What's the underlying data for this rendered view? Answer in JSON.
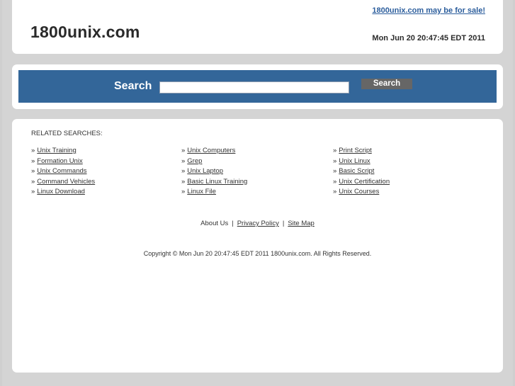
{
  "header": {
    "site_title": "1800unix.com",
    "sale_link": "1800unix.com may be for sale!",
    "datetime": "Mon Jun 20 20:47:45 EDT 2011"
  },
  "search": {
    "label": "Search",
    "input_value": "",
    "button_label": "Search"
  },
  "related": {
    "title": "RELATED SEARCHES:",
    "bullet": "»",
    "columns": [
      [
        "Unix Training",
        "Formation Unix",
        "Unix Commands",
        "Command Vehicles",
        "Linux Download"
      ],
      [
        "Unix Computers",
        "Grep",
        "Unix Laptop",
        "Basic Linux Training",
        "Linux File"
      ],
      [
        "Print Script",
        "Unix Linux",
        "Basic Script",
        "Unix Certification",
        "Unix Courses"
      ]
    ]
  },
  "footer": {
    "links": {
      "about": "About Us",
      "privacy": "Privacy Policy",
      "sitemap": "Site Map"
    },
    "separator": "|",
    "copyright": "Copyright © Mon Jun 20 20:47:45 EDT 2011 1800unix.com. All Rights Reserved."
  },
  "colors": {
    "search_bar": "#336699",
    "sale_link": "#2b5d9c",
    "button": "#666666",
    "page_background": "#cfcfcf"
  }
}
